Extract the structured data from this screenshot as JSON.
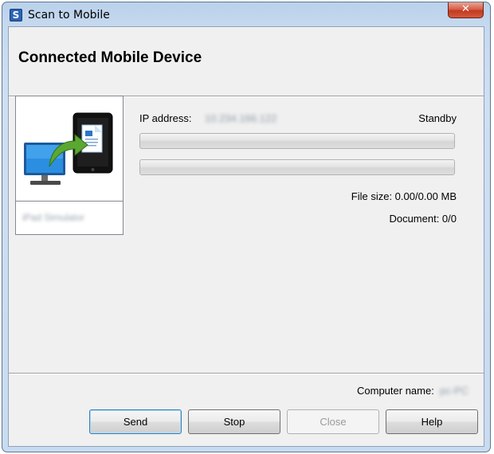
{
  "window": {
    "title": "Scan to Mobile",
    "app_icon_glyph": "S",
    "close_glyph": "✕"
  },
  "header": {
    "title": "Connected Mobile Device"
  },
  "device": {
    "image_icon": "computer-to-mobile-transfer-icon",
    "name": "iPad Simulator"
  },
  "info": {
    "ip_label": "IP address:",
    "ip_value": "10.234.166.122",
    "status": "Standby",
    "progress": [
      0,
      0
    ],
    "file_size": "File size: 0.00/0.00 MB",
    "document": "Document: 0/0"
  },
  "footer": {
    "computer_name_label": "Computer name:",
    "computer_name_value": "pc-PC"
  },
  "buttons": {
    "send": "Send",
    "stop": "Stop",
    "close": "Close",
    "help": "Help"
  },
  "colors": {
    "titlebar": "#b9d1ea",
    "close_button": "#c3391f",
    "client_bg": "#f0f0f0",
    "monitor_blue": "#1a7fd0",
    "arrow_green": "#5aa832"
  }
}
